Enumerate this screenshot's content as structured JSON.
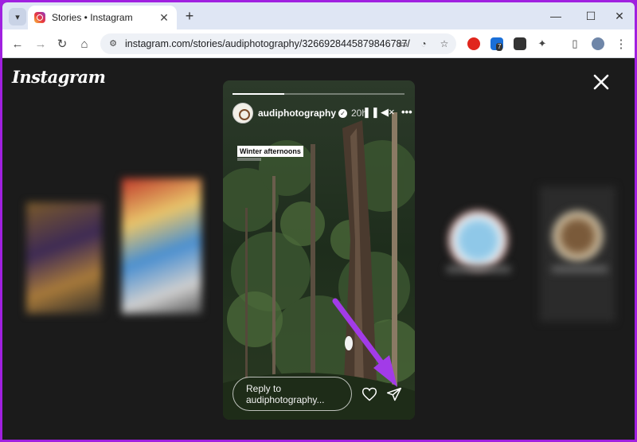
{
  "browser": {
    "tab_title": "Stories • Instagram",
    "url": "instagram.com/stories/audiphotography/3266928445879846787/",
    "extension_badge": "7"
  },
  "page": {
    "logo_text": "Instagram",
    "story": {
      "username": "audiphotography",
      "time_ago": "20h",
      "sticker_text": "Winter afternoons",
      "reply_placeholder": "Reply to audiphotography..."
    }
  },
  "colors": {
    "accent_arrow": "#a23be8",
    "page_bg": "#1b1b1b"
  },
  "icons": [
    "tab-search-icon",
    "instagram-favicon",
    "close-icon",
    "new-tab-icon",
    "minimize-icon",
    "maximize-icon",
    "back-icon",
    "forward-icon",
    "reload-icon",
    "home-icon",
    "site-info-icon",
    "cast-icon",
    "performance-icon",
    "bookmark-star-icon",
    "opera-extension-icon",
    "badge-extension-icon",
    "incognito-extension-icon",
    "puzzle-icon",
    "sidebar-icon",
    "profile-avatar",
    "kebab-menu-icon",
    "pause-icon",
    "mute-icon",
    "more-icon",
    "heart-icon",
    "send-icon"
  ]
}
